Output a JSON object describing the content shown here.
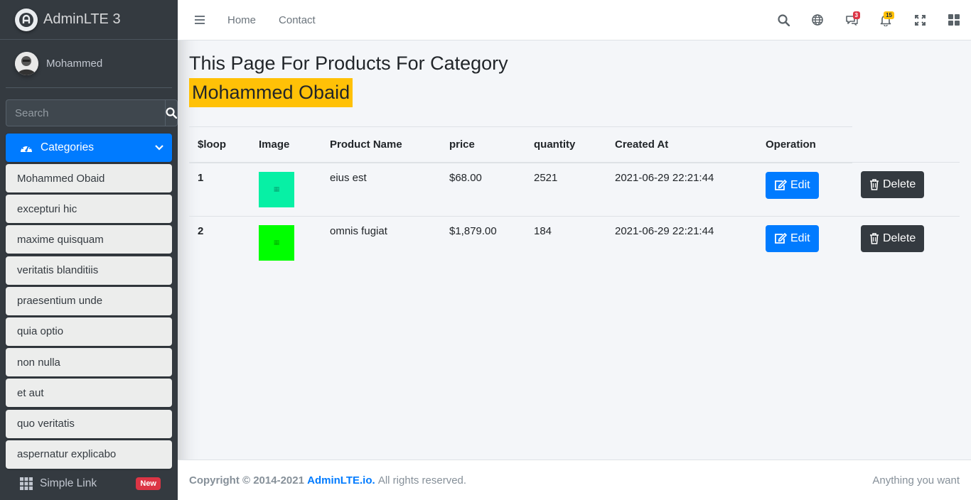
{
  "brand": {
    "name": "AdminLTE 3"
  },
  "user": {
    "name": "Mohammed"
  },
  "search": {
    "placeholder": "Search"
  },
  "nav": {
    "active_label": "Categories",
    "categories": [
      "Mohammed Obaid",
      "excepturi hic",
      "maxime quisquam",
      "veritatis blanditiis",
      "praesentium unde",
      "quia optio",
      "non nulla",
      "et aut",
      "quo veritatis",
      "aspernatur explicabo"
    ],
    "simple_link": "Simple Link",
    "simple_link_badge": "New"
  },
  "topbar": {
    "links": [
      "Home",
      "Contact"
    ],
    "messages_count": "3",
    "notifications_count": "15"
  },
  "page": {
    "title": "This Page For Products For Category",
    "category_name": "Mohammed Obaid"
  },
  "table": {
    "headers": [
      "$loop",
      "Image",
      "Product Name",
      "price",
      "quantity",
      "Created At",
      "Operation"
    ],
    "rows": [
      {
        "loop": "1",
        "image_color": "#07f0a5",
        "name": "eius est",
        "price": "$68.00",
        "quantity": "2521",
        "created_at": "2021-06-29 22:21:44",
        "edit": "Edit",
        "delete": "Delete"
      },
      {
        "loop": "2",
        "image_color": "#00ff00",
        "name": "omnis fugiat",
        "price": "$1,879.00",
        "quantity": "184",
        "created_at": "2021-06-29 22:21:44",
        "edit": "Edit",
        "delete": "Delete"
      }
    ]
  },
  "footer": {
    "copyright": "Copyright © 2014-2021",
    "link": "AdminLTE.io.",
    "rights": "All rights reserved.",
    "right_text": "Anything you want"
  },
  "colors": {
    "primary": "#007bff",
    "sidebar": "#343a40",
    "highlight": "#ffc107",
    "danger": "#dc3545"
  }
}
